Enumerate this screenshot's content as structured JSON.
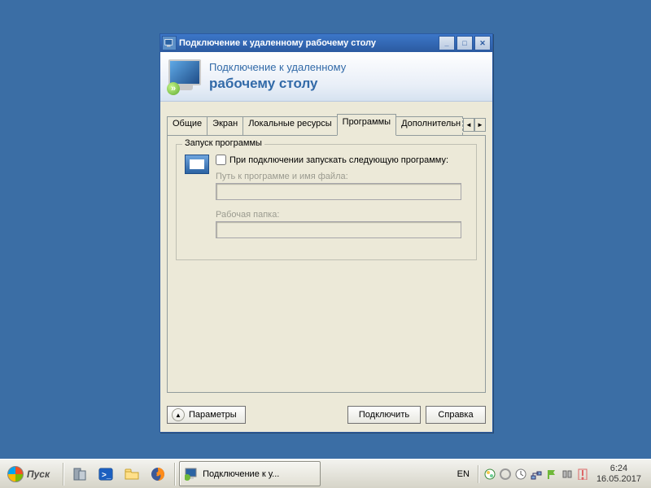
{
  "window": {
    "title": "Подключение к удаленному рабочему столу",
    "banner_line1": "Подключение к удаленному",
    "banner_line2": "рабочему столу"
  },
  "tabs": {
    "items": [
      {
        "label": "Общие"
      },
      {
        "label": "Экран"
      },
      {
        "label": "Локальные ресурсы"
      },
      {
        "label": "Программы"
      },
      {
        "label": "Дополнительн"
      }
    ],
    "active_index": 3
  },
  "programs_tab": {
    "group_title": "Запуск программы",
    "checkbox_label": "При подключении запускать следующую программу:",
    "checkbox_checked": false,
    "path_label": "Путь к программе и имя файла:",
    "path_value": "",
    "workdir_label": "Рабочая папка:",
    "workdir_value": ""
  },
  "buttons": {
    "options": "Параметры",
    "connect": "Подключить",
    "help": "Справка"
  },
  "taskbar": {
    "start": "Пуск",
    "active_task": "Подключение к у...",
    "lang": "EN",
    "time": "6:24",
    "date": "16.05.2017"
  }
}
